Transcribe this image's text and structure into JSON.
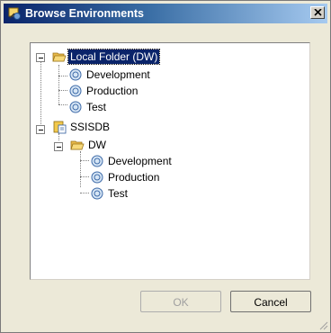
{
  "window": {
    "title": "Browse Environments"
  },
  "tree": {
    "folder": {
      "label": "Local Folder (DW)",
      "children": [
        "Development",
        "Production",
        "Test"
      ]
    },
    "catalog": {
      "label": "SSISDB",
      "folder": {
        "label": "DW",
        "children": [
          "Development",
          "Production",
          "Test"
        ]
      }
    }
  },
  "buttons": {
    "ok": "OK",
    "cancel": "Cancel"
  },
  "icons": {
    "title": "environment-browse-icon",
    "folder": "folder-open-icon",
    "environment": "environment-icon",
    "catalog": "ssisdb-catalog-icon"
  }
}
